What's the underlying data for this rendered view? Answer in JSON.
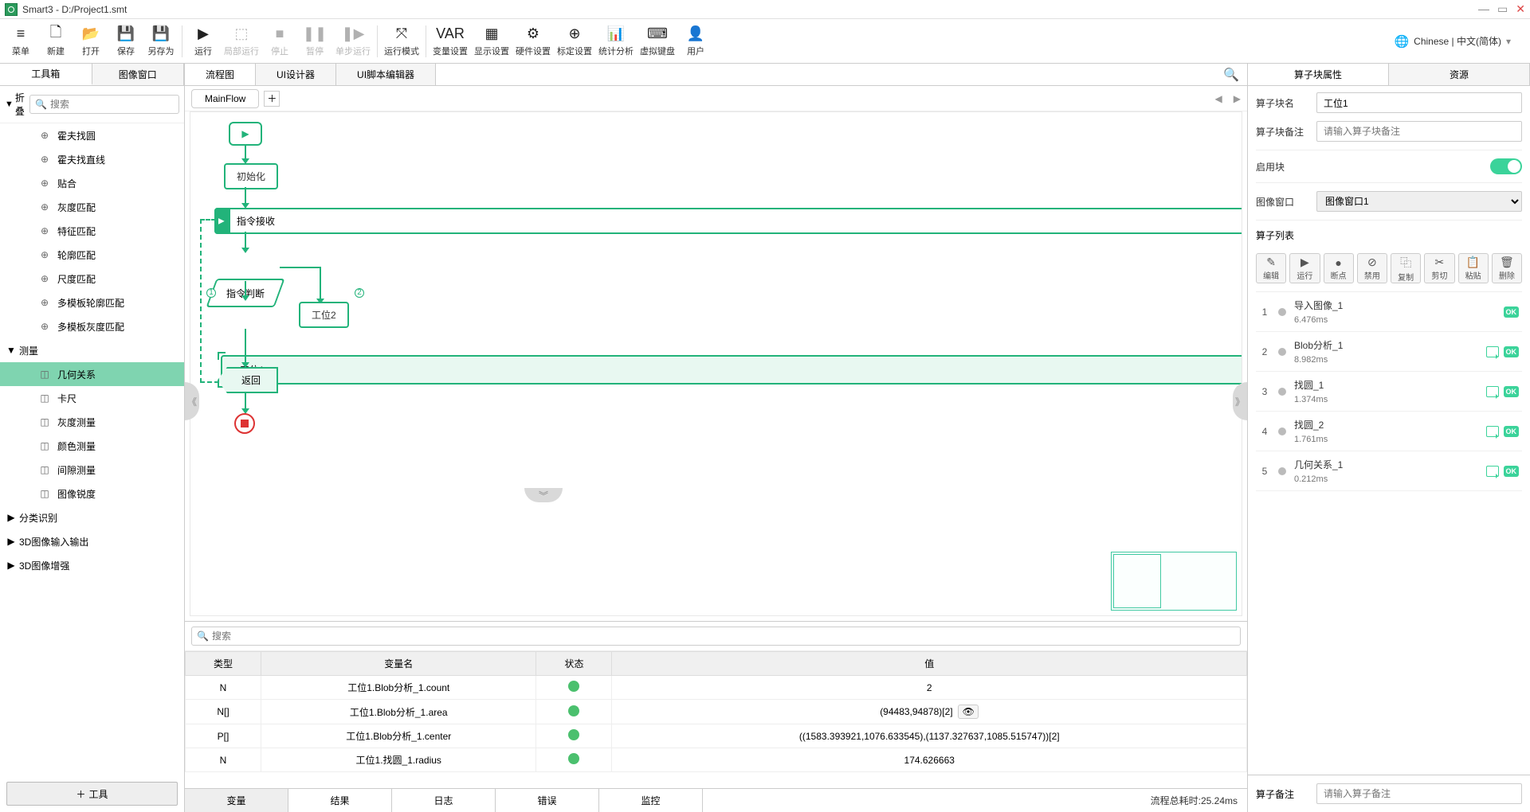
{
  "title": "Smart3 - D:/Project1.smt",
  "lang": "Chinese | 中文(简体)",
  "toolbar": [
    {
      "id": "menu",
      "label": "菜单",
      "icon": "≡"
    },
    {
      "id": "new",
      "label": "新建",
      "icon": "🗋"
    },
    {
      "id": "open",
      "label": "打开",
      "icon": "📂"
    },
    {
      "id": "save",
      "label": "保存",
      "icon": "💾"
    },
    {
      "id": "saveas",
      "label": "另存为",
      "icon": "💾"
    },
    {
      "sep": true
    },
    {
      "id": "run",
      "label": "运行",
      "icon": "▶"
    },
    {
      "id": "runpart",
      "label": "局部运行",
      "icon": "⬚",
      "disabled": true
    },
    {
      "id": "stop",
      "label": "停止",
      "icon": "■",
      "disabled": true
    },
    {
      "id": "pause",
      "label": "暂停",
      "icon": "❚❚",
      "disabled": true
    },
    {
      "id": "step",
      "label": "单步运行",
      "icon": "❚▶",
      "disabled": true
    },
    {
      "sep": true
    },
    {
      "id": "runmode",
      "label": "运行模式",
      "icon": "⤧"
    },
    {
      "sep": true
    },
    {
      "id": "var",
      "label": "变量设置",
      "icon": "VAR"
    },
    {
      "id": "disp",
      "label": "显示设置",
      "icon": "▦"
    },
    {
      "id": "hw",
      "label": "硬件设置",
      "icon": "⚙"
    },
    {
      "id": "calib",
      "label": "标定设置",
      "icon": "⊕"
    },
    {
      "id": "stat",
      "label": "统计分析",
      "icon": "📊"
    },
    {
      "id": "kbd",
      "label": "虚拟键盘",
      "icon": "⌨"
    },
    {
      "id": "user",
      "label": "用户",
      "icon": "👤"
    }
  ],
  "left": {
    "tabs": [
      "工具箱",
      "图像窗口"
    ],
    "fold": "折叠",
    "search_ph": "搜索",
    "items1": [
      "霍夫找圆",
      "霍夫找直线",
      "贴合",
      "灰度匹配",
      "特征匹配",
      "轮廓匹配",
      "尺度匹配",
      "多模板轮廓匹配",
      "多模板灰度匹配"
    ],
    "cat_measure": "测量",
    "measure_items": [
      "几何关系",
      "卡尺",
      "灰度测量",
      "颜色测量",
      "间隙测量",
      "图像锐度"
    ],
    "cats_more": [
      "分类识别",
      "3D图像输入输出",
      "3D图像增强"
    ],
    "add_tool": "工具"
  },
  "center": {
    "tabs": [
      "流程图",
      "UI设计器",
      "UI脚本编辑器"
    ],
    "flow_name": "MainFlow",
    "nodes": {
      "init": "初始化",
      "recv": "指令接收",
      "judge": "指令判断",
      "s1": "工位1",
      "s2": "工位2",
      "ret": "返回"
    }
  },
  "bottom": {
    "search_ph": "搜索",
    "headers": [
      "类型",
      "变量名",
      "状态",
      "值"
    ],
    "rows": [
      {
        "type": "N",
        "name": "工位1.Blob分析_1.count",
        "val": "2",
        "eye": false
      },
      {
        "type": "N[]",
        "name": "工位1.Blob分析_1.area",
        "val": "(94483,94878)[2]",
        "eye": true
      },
      {
        "type": "P[]",
        "name": "工位1.Blob分析_1.center",
        "val": "((1583.393921,1076.633545),(1137.327637,1085.515747))[2]",
        "eye": false
      },
      {
        "type": "N",
        "name": "工位1.找圆_1.radius",
        "val": "174.626663",
        "eye": false
      }
    ],
    "tabs": [
      "变量",
      "结果",
      "日志",
      "错误",
      "监控"
    ],
    "status_label": "流程总耗时",
    "status_val": "25.24ms"
  },
  "right": {
    "tabs": [
      "算子块属性",
      "资源"
    ],
    "name_label": "算子块名",
    "name_val": "工位1",
    "remark_label": "算子块备注",
    "remark_ph": "请输入算子块备注",
    "enable_label": "启用块",
    "imgwin_label": "图像窗口",
    "imgwin_val": "图像窗口1",
    "list_label": "算子列表",
    "ops": [
      {
        "label": "编辑",
        "icon": "✎"
      },
      {
        "label": "运行",
        "icon": "▶"
      },
      {
        "label": "断点",
        "icon": "●"
      },
      {
        "label": "禁用",
        "icon": "⊘"
      },
      {
        "label": "复制",
        "icon": "⿻"
      },
      {
        "label": "剪切",
        "icon": "✂"
      },
      {
        "label": "粘贴",
        "icon": "📋"
      },
      {
        "label": "删除",
        "icon": "🗑"
      }
    ],
    "items": [
      {
        "name": "导入图像_1",
        "time": "6.476ms",
        "img": false
      },
      {
        "name": "Blob分析_1",
        "time": "8.982ms",
        "img": true
      },
      {
        "name": "找圆_1",
        "time": "1.374ms",
        "img": true
      },
      {
        "name": "找圆_2",
        "time": "1.761ms",
        "img": true
      },
      {
        "name": "几何关系_1",
        "time": "0.212ms",
        "img": true
      }
    ],
    "remark2_label": "算子备注",
    "remark2_ph": "请输入算子备注"
  }
}
